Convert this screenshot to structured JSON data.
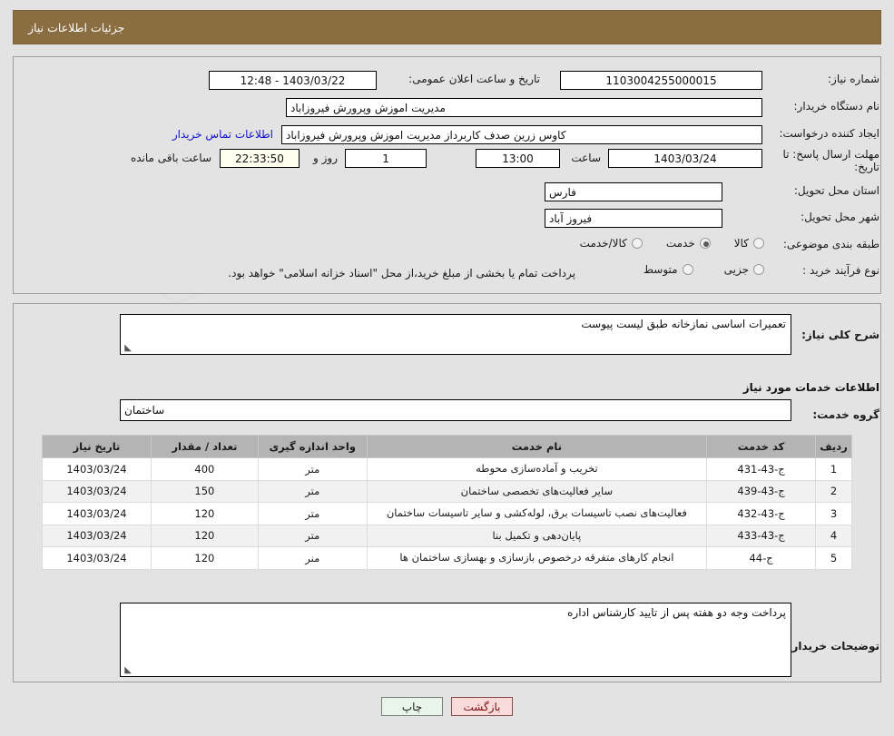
{
  "header": {
    "title": "جزئیات اطلاعات نیاز"
  },
  "form": {
    "need_number": {
      "label": "شماره نیاز:",
      "value": "1103004255000015"
    },
    "announce": {
      "label": "تاریخ و ساعت اعلان عمومی:",
      "value": "1403/03/22 - 12:48"
    },
    "buyer_org": {
      "label": "نام دستگاه خریدار:",
      "value": "مدیریت اموزش وپرورش فیروزاباد"
    },
    "requester": {
      "label": "ایجاد کننده درخواست:",
      "value": "کاوس زرین صدف کاربرداز مدیریت اموزش وپرورش فیروزاباد"
    },
    "contact_link": "اطلاعات تماس خریدار",
    "deadline": {
      "label_line1": "مهلت ارسال پاسخ: تا",
      "label_line2": "تاریخ:",
      "date": "1403/03/24",
      "time_label": "ساعت",
      "time": "13:00",
      "days": "1",
      "days_label": "روز و",
      "countdown": "22:33:50",
      "remaining_label": "ساعت باقی مانده"
    },
    "province": {
      "label": "استان محل تحویل:",
      "value": "فارس"
    },
    "city": {
      "label": "شهر محل تحویل:",
      "value": "فیروز آباد"
    },
    "category": {
      "label": "طبقه بندی موضوعی:",
      "options": [
        "کالا",
        "خدمت",
        "کالا/خدمت"
      ],
      "selected": "خدمت"
    },
    "purchase_type": {
      "label": "نوع فرآیند خرید :",
      "options": [
        "جزیی",
        "متوسط"
      ],
      "selected": "",
      "note": "پرداخت تمام یا بخشی از مبلغ خرید،از محل \"اسناد خزانه اسلامی\" خواهد بود."
    }
  },
  "description": {
    "label": "شرح کلی نیاز:",
    "value": "تعمیرات اساسی نمازخانه طبق لیست پیوست"
  },
  "services_section": {
    "title": "اطلاعات خدمات مورد نیاز",
    "group_label": "گروه خدمت:",
    "group_value": "ساختمان"
  },
  "table": {
    "headers": [
      "ردیف",
      "کد خدمت",
      "نام خدمت",
      "واحد اندازه گیری",
      "تعداد / مقدار",
      "تاریخ نیاز"
    ],
    "rows": [
      {
        "no": "1",
        "code": "ج-43-431",
        "name": "تخریب و آماده‌سازی محوطه",
        "unit": "متر",
        "qty": "400",
        "date": "1403/03/24"
      },
      {
        "no": "2",
        "code": "ج-43-439",
        "name": "سایر فعالیت‌های تخصصی ساختمان",
        "unit": "متر",
        "qty": "150",
        "date": "1403/03/24"
      },
      {
        "no": "3",
        "code": "ج-43-432",
        "name": "فعالیت‌های نصب تاسیسات برق، لوله‌کشی و سایر تاسیسات ساختمان",
        "unit": "متر",
        "qty": "120",
        "date": "1403/03/24"
      },
      {
        "no": "4",
        "code": "ج-43-433",
        "name": "پایان‌دهی و تکمیل بنا",
        "unit": "متر",
        "qty": "120",
        "date": "1403/03/24"
      },
      {
        "no": "5",
        "code": "ج-44",
        "name": "انجام کارهای متفرقه درخصوص بازسازی و بهسازی ساختمان ها",
        "unit": "منر",
        "qty": "120",
        "date": "1403/03/24"
      }
    ]
  },
  "buyer_notes": {
    "label": "توضیحات خریدار:",
    "value": "پرداخت وجه دو هفته پس از تایید کارشناس اداره"
  },
  "buttons": {
    "print": "چاپ",
    "back": "بازگشت"
  },
  "watermark": "AriaTender.net",
  "colors": {
    "header_bar": "#8a6d41",
    "link": "#1111cc",
    "table_header": "#b4b4b4",
    "back_button": "#fadbdb",
    "print_button": "#e9f5e9"
  }
}
